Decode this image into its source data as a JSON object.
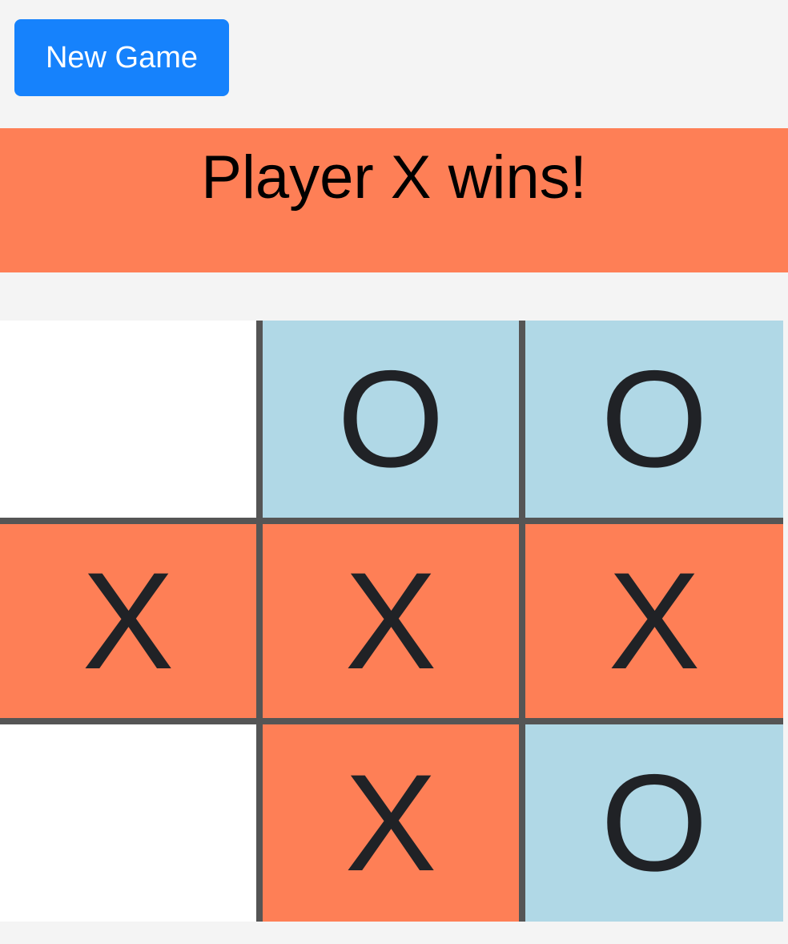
{
  "controls": {
    "new_game_label": "New Game"
  },
  "status": {
    "message": "Player X wins!"
  },
  "colors": {
    "background": "#f4f4f4",
    "button": "#1682fc",
    "x_cell": "#fe7f56",
    "o_cell": "#b0d8e6",
    "empty_cell": "#ffffff",
    "grid_line": "#555555",
    "mark": "#202226"
  },
  "board": {
    "cells": [
      [
        "",
        "O",
        "O"
      ],
      [
        "X",
        "X",
        "X"
      ],
      [
        "",
        "X",
        "O"
      ]
    ]
  }
}
